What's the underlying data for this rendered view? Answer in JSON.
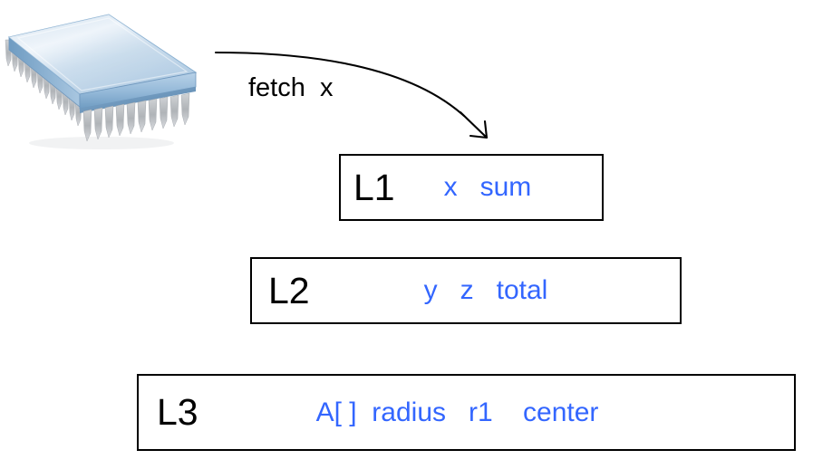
{
  "diagram": {
    "processor": {
      "icon": "cpu-chip-icon",
      "colors": {
        "top_light": "#d6e4f2",
        "top_mid": "#b6cee6",
        "top_dark": "#8fb4d6",
        "side": "#7ba4cc",
        "pin": "#b9bcbf",
        "edge": "#6f97bd"
      }
    },
    "arrow": {
      "label": "fetch  x",
      "color": "#000000"
    },
    "levels": [
      {
        "name": "L1",
        "items": "x   sum",
        "item_color": "#3366ff",
        "name_color": "#000000"
      },
      {
        "name": "L2",
        "items": "y   z   total",
        "item_color": "#3366ff",
        "name_color": "#000000"
      },
      {
        "name": "L3",
        "items": "A[ ]  radius   r1    center",
        "item_color": "#3366ff",
        "name_color": "#000000"
      }
    ]
  }
}
